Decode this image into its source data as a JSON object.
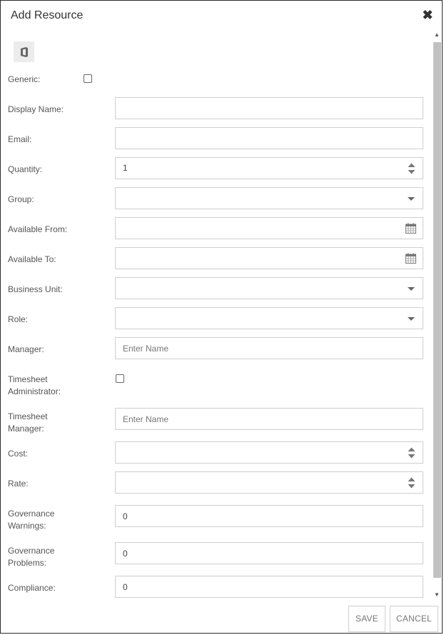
{
  "dialog": {
    "title": "Add Resource"
  },
  "fields": {
    "generic": {
      "label": "Generic:"
    },
    "display_name": {
      "label": "Display Name:",
      "value": ""
    },
    "email": {
      "label": "Email:",
      "value": ""
    },
    "quantity": {
      "label": "Quantity:",
      "value": "1"
    },
    "group": {
      "label": "Group:",
      "value": ""
    },
    "available_from": {
      "label": "Available From:",
      "value": ""
    },
    "available_to": {
      "label": "Available To:",
      "value": ""
    },
    "business_unit": {
      "label": "Business Unit:",
      "value": ""
    },
    "role": {
      "label": "Role:",
      "value": ""
    },
    "manager": {
      "label": "Manager:",
      "placeholder": "Enter Name"
    },
    "timesheet_admin": {
      "label_line1": "Timesheet",
      "label_line2": "Administrator:"
    },
    "timesheet_manager": {
      "label_line1": "Timesheet",
      "label_line2": "Manager:",
      "placeholder": "Enter Name"
    },
    "cost": {
      "label": "Cost:",
      "value": ""
    },
    "rate": {
      "label": "Rate:",
      "value": ""
    },
    "governance_warnings": {
      "label_line1": "Governance",
      "label_line2": "Warnings:",
      "value": "0"
    },
    "governance_problems": {
      "label_line1": "Governance",
      "label_line2": "Problems:",
      "value": "0"
    },
    "compliance": {
      "label": "Compliance:",
      "value": "0"
    }
  },
  "buttons": {
    "save": "SAVE",
    "cancel": "CANCEL"
  },
  "icons": {
    "close": "close-icon",
    "office": "office-icon",
    "calendar": "calendar-icon",
    "spinner": "spinner-arrows-icon",
    "dropdown": "chevron-down-icon"
  }
}
